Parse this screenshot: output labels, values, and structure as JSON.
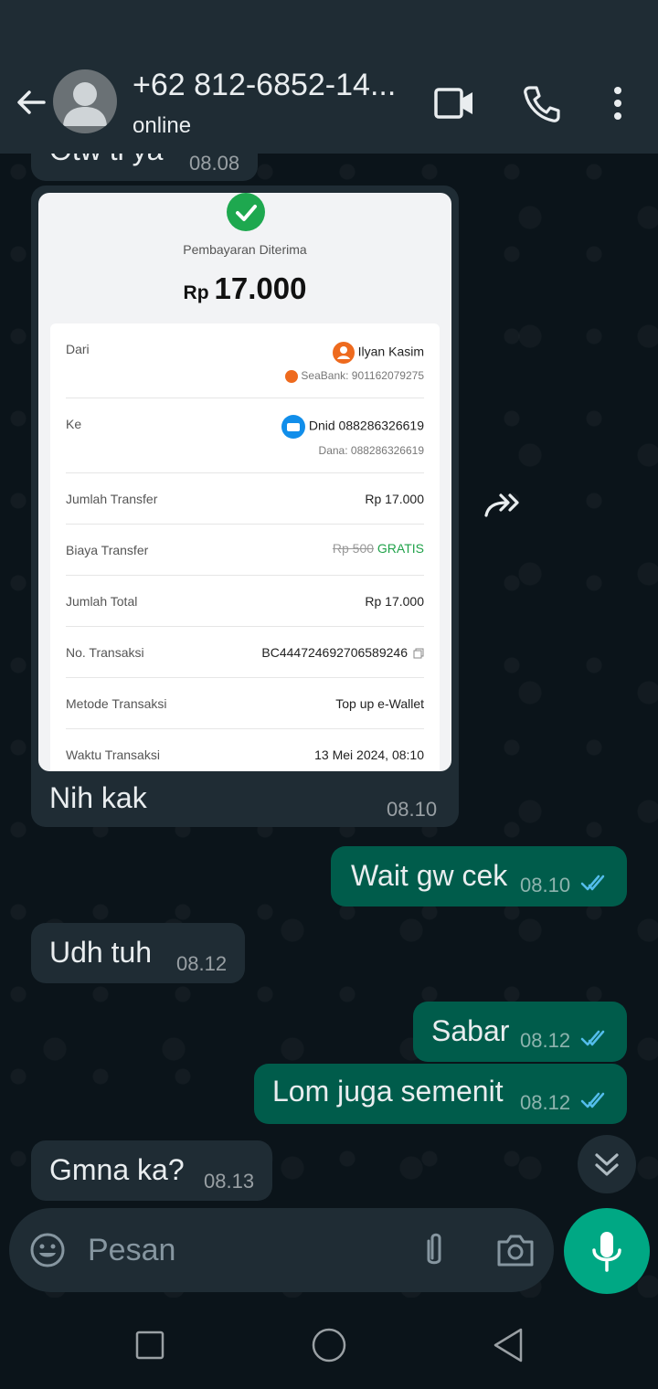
{
  "header": {
    "contact_name": "+62 812-6852-14...",
    "contact_status": "online",
    "icons": [
      "back-arrow-icon",
      "avatar",
      "video-call-icon",
      "phone-icon",
      "more-vert-icon"
    ]
  },
  "messages": {
    "partial_top": {
      "text": "Otw ti ya",
      "time": "08.08"
    },
    "receipt_message": {
      "receipt": {
        "status": "Pembayaran Diterima",
        "currency": "Rp",
        "amount": "17.000",
        "from_label": "Dari",
        "from_name": "Ilyan Kasim",
        "from_account": "SeaBank: 901162079275",
        "to_label": "Ke",
        "to_name": "Dnid 088286326619",
        "to_account": "Dana: 088286326619",
        "rows": [
          {
            "label": "Jumlah Transfer",
            "value": "Rp 17.000"
          },
          {
            "label": "Biaya Transfer",
            "value_strike": "Rp 500",
            "value": "GRATIS"
          },
          {
            "label": "Jumlah Total",
            "value": "Rp 17.000"
          },
          {
            "label": "No. Transaksi",
            "value": "BC444724692706589246"
          },
          {
            "label": "Metode Transaksi",
            "value": "Top up e-Wallet"
          },
          {
            "label": "Waktu Transaksi",
            "value": "13 Mei 2024, 08:10"
          }
        ]
      },
      "caption": "Nih kak",
      "time": "08.10"
    },
    "m1": {
      "text": "Wait gw cek",
      "time": "08.10",
      "direction": "out"
    },
    "m2": {
      "text": "Udh tuh",
      "time": "08.12",
      "direction": "in"
    },
    "m3": {
      "text": "Sabar",
      "time": "08.12",
      "direction": "out"
    },
    "m4": {
      "text": "Lom juga semenit",
      "time": "08.12",
      "direction": "out"
    },
    "m5": {
      "text": "Gmna ka?",
      "time": "08.13",
      "direction": "in"
    }
  },
  "composer": {
    "placeholder": "Pesan"
  },
  "colors": {
    "header_bg": "#1f2c34",
    "incoming_bubble": "#1f2c34",
    "outgoing_bubble": "#005c4b",
    "accent": "#00a884",
    "read_tick": "#53bdeb"
  }
}
